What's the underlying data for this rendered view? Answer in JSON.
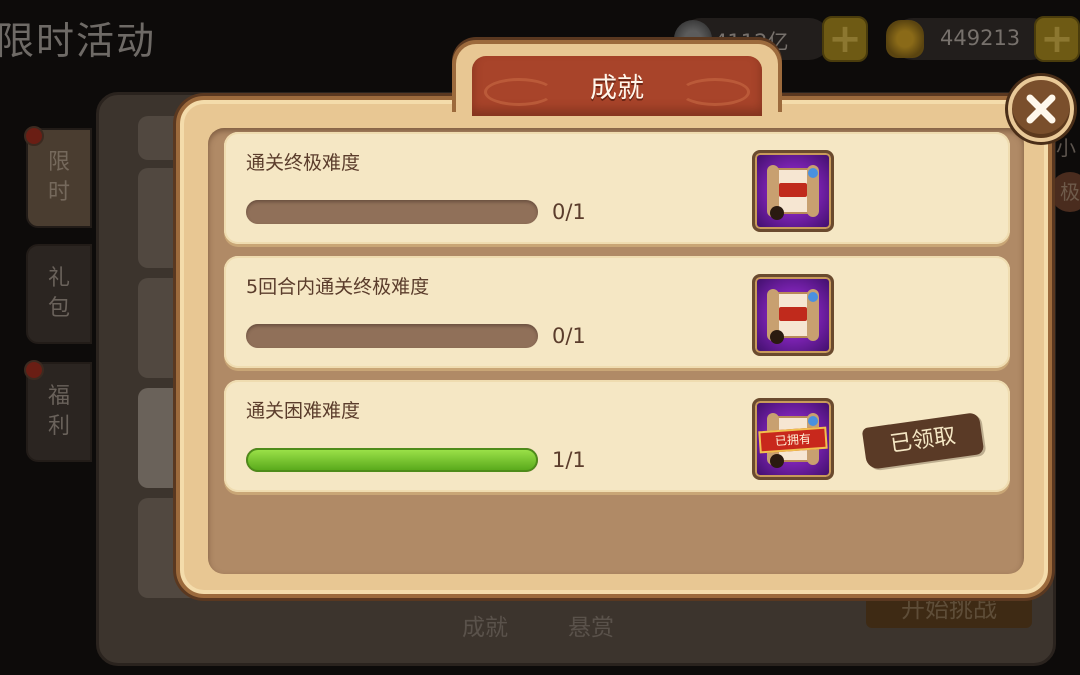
{
  "page": {
    "title": "限时活动"
  },
  "currencies": [
    {
      "icon": "silver-coin-icon",
      "value": "4112亿"
    },
    {
      "icon": "gold-ingot-icon",
      "value": "449213"
    }
  ],
  "side_tabs": [
    {
      "label": "限时",
      "has_dot": true
    },
    {
      "label": "礼包",
      "has_dot": false
    },
    {
      "label": "福利",
      "has_dot": true
    }
  ],
  "background": {
    "bottom_tabs": [
      "成就",
      "悬赏"
    ],
    "start_button": "开始挑战",
    "right_tag": "小",
    "right_circle": "极"
  },
  "modal": {
    "title": "成就",
    "close_icon": "close-icon",
    "achievements": [
      {
        "title": "通关终极难度",
        "progress_text": "0/1",
        "progress_fraction": 0,
        "reward_icon": "title-scroll-icon",
        "reward_owned_label": "",
        "claimed_label": ""
      },
      {
        "title": "5回合内通关终极难度",
        "progress_text": "0/1",
        "progress_fraction": 0,
        "reward_icon": "title-scroll-icon",
        "reward_owned_label": "",
        "claimed_label": ""
      },
      {
        "title": "通关困难难度",
        "progress_text": "1/1",
        "progress_fraction": 1,
        "reward_icon": "title-scroll-icon",
        "reward_owned_label": "已拥有",
        "claimed_label": "已领取"
      }
    ]
  },
  "colors": {
    "progress_fill": "#6cc02a",
    "progress_track": "#907059",
    "title_tab": "#a8442a",
    "panel_cream": "#e8c793"
  }
}
